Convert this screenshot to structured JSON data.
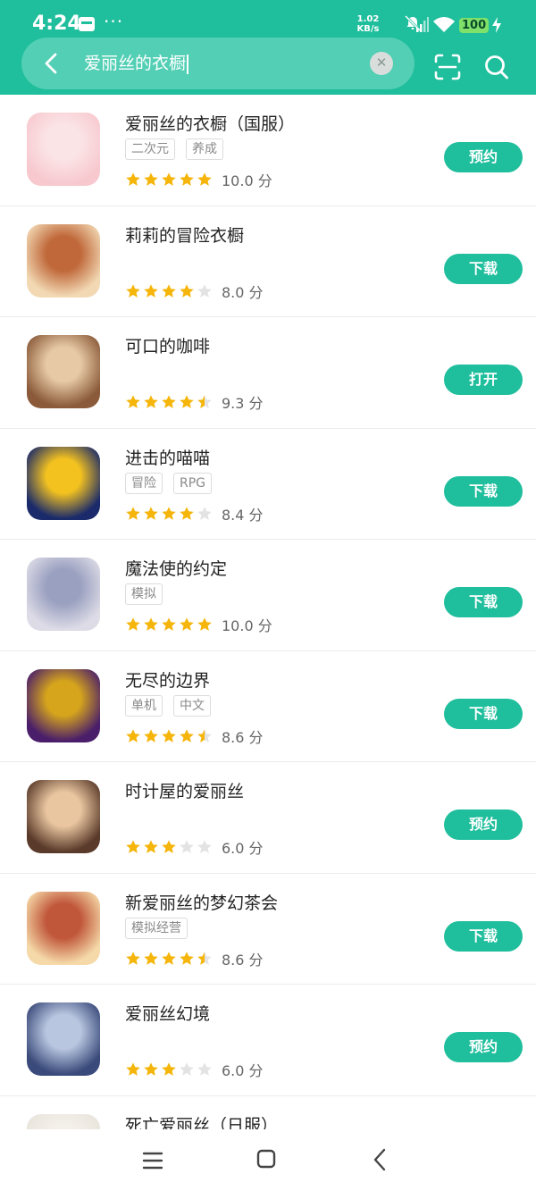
{
  "status": {
    "time": "4:24",
    "speed_value": "1.02",
    "speed_unit": "KB/s",
    "battery": "100"
  },
  "search": {
    "query": "爱丽丝的衣橱"
  },
  "results": [
    {
      "name": "爱丽丝的衣橱（国服）",
      "tags": [
        "二次元",
        "养成"
      ],
      "stars": 5,
      "score": "10.0 分",
      "action": "预约",
      "icon_colors": [
        "#f7c9cf",
        "#fbe4e6"
      ]
    },
    {
      "name": "莉莉的冒险衣橱",
      "tags": [],
      "stars": 4,
      "score": "8.0 分",
      "action": "下载",
      "icon_colors": [
        "#f2d9b4",
        "#c0683a"
      ]
    },
    {
      "name": "可口的咖啡",
      "tags": [],
      "stars": 4.5,
      "score": "9.3 分",
      "action": "打开",
      "icon_colors": [
        "#8a5a3a",
        "#e7c9a5"
      ]
    },
    {
      "name": "进击的喵喵",
      "tags": [
        "冒险",
        "RPG"
      ],
      "stars": 4,
      "score": "8.4 分",
      "action": "下载",
      "icon_colors": [
        "#1a2a6a",
        "#f4c21f"
      ]
    },
    {
      "name": "魔法使的约定",
      "tags": [
        "模拟"
      ],
      "stars": 5,
      "score": "10.0 分",
      "action": "下载",
      "icon_colors": [
        "#dcdbe6",
        "#9aa0c0"
      ]
    },
    {
      "name": "无尽的边界",
      "tags": [
        "单机",
        "中文"
      ],
      "stars": 4.5,
      "score": "8.6 分",
      "action": "下载",
      "icon_colors": [
        "#4a1e6a",
        "#d6a51c"
      ]
    },
    {
      "name": "时计屋的爱丽丝",
      "tags": [],
      "stars": 3,
      "score": "6.0 分",
      "action": "预约",
      "icon_colors": [
        "#5a3a2a",
        "#e9c6a0"
      ]
    },
    {
      "name": "新爱丽丝的梦幻茶会",
      "tags": [
        "模拟经营"
      ],
      "stars": 4.5,
      "score": "8.6 分",
      "action": "下载",
      "icon_colors": [
        "#f5d9a8",
        "#c0563a"
      ]
    },
    {
      "name": "爱丽丝幻境",
      "tags": [],
      "stars": 3,
      "score": "6.0 分",
      "action": "预约",
      "icon_colors": [
        "#3a4a7a",
        "#b8c6e0"
      ]
    },
    {
      "name": "死亡爱丽丝（日服）",
      "tags": [],
      "stars": 0,
      "score": "",
      "action": "",
      "icon_colors": [
        "#e8e4dc",
        "#f4f1ea"
      ]
    }
  ],
  "colors": {
    "accent": "#1fbe9c",
    "star": "#f5b50a",
    "star_empty": "#e3e3e3"
  }
}
